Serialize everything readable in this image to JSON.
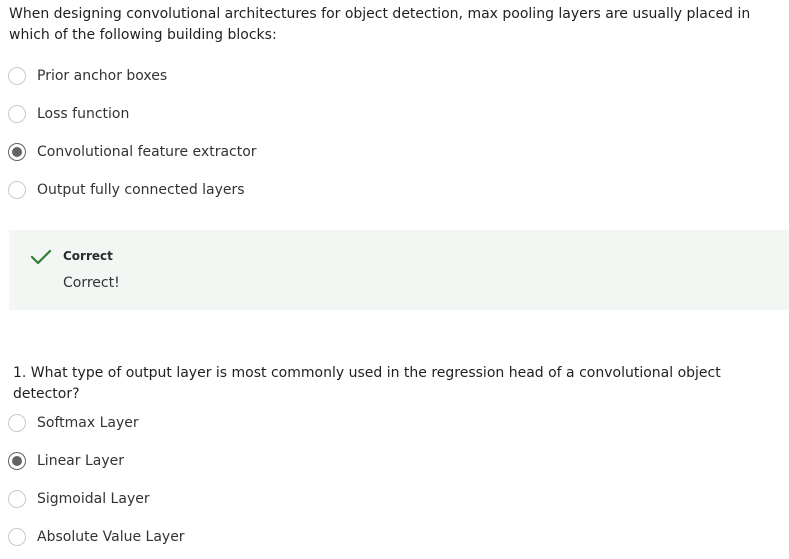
{
  "question1": {
    "text": "When designing convolutional architectures for object detection, max pooling layers are usually placed in which of the following building blocks:",
    "options": [
      {
        "label": "Prior anchor boxes",
        "selected": false
      },
      {
        "label": "Loss function",
        "selected": false
      },
      {
        "label": "Convolutional feature extractor",
        "selected": true
      },
      {
        "label": "Output fully connected layers",
        "selected": false
      }
    ]
  },
  "feedback": {
    "icon": "check-icon",
    "title": "Correct",
    "message": "Correct!",
    "color": "#2e7d32",
    "background": "#f2f7f4"
  },
  "question2": {
    "text": "1. What type of output layer is most commonly used in the regression head of a convolutional object detector?",
    "options": [
      {
        "label": "Softmax Layer",
        "selected": false
      },
      {
        "label": "Linear Layer",
        "selected": true
      },
      {
        "label": "Sigmoidal Layer",
        "selected": false
      },
      {
        "label": "Absolute Value Layer",
        "selected": false
      }
    ]
  }
}
